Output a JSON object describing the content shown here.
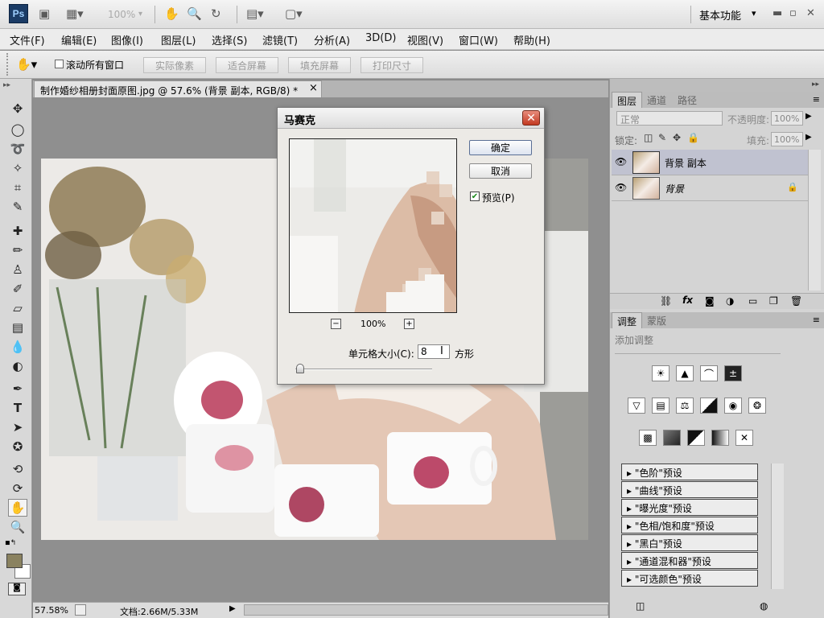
{
  "app": {
    "logo": "Ps",
    "workspace": "基本功能",
    "zoom_select": "100%"
  },
  "menu": [
    "文件(F)",
    "编辑(E)",
    "图像(I)",
    "图层(L)",
    "选择(S)",
    "滤镜(T)",
    "分析(A)",
    "3D(D)",
    "视图(V)",
    "窗口(W)",
    "帮助(H)"
  ],
  "options": {
    "scroll_all_label": "滚动所有窗口",
    "buttons": [
      "实际像素",
      "适合屏幕",
      "填充屏幕",
      "打印尺寸"
    ]
  },
  "document": {
    "tab_title": "制作婚纱相册封面原图.jpg @ 57.6% (背景 副本, RGB/8) *",
    "close_glyph": "×"
  },
  "status": {
    "zoom": "57.58%",
    "doc_info": "文档:2.66M/5.33M"
  },
  "dialog": {
    "title": "马赛克",
    "close_glyph": "✕",
    "ok": "确定",
    "cancel": "取消",
    "preview_label": "预览(P)",
    "preview_checked": true,
    "zoom_pct": "100%",
    "minus": "−",
    "plus": "+",
    "cell_size_label": "单元格大小(C):",
    "cell_size_value": "8",
    "cell_unit": "方形",
    "slider_pct": 2
  },
  "layers_panel": {
    "tabs": [
      "图层",
      "通道",
      "路径"
    ],
    "blend_mode": "正常",
    "opacity_label": "不透明度:",
    "opacity_value": "100%",
    "lock_label": "锁定:",
    "fill_label": "填充:",
    "fill_value": "100%",
    "layers": [
      {
        "name": "背景 副本",
        "selected": true,
        "locked": false
      },
      {
        "name": "背景",
        "selected": false,
        "locked": true
      }
    ]
  },
  "adjust_panel": {
    "tabs": [
      "调整",
      "蒙版"
    ],
    "add_label": "添加调整",
    "presets": [
      "\"色阶\"预设",
      "\"曲线\"预设",
      "\"曝光度\"预设",
      "\"色相/饱和度\"预设",
      "\"黑白\"预设",
      "\"通道混和器\"预设",
      "\"可选颜色\"预设"
    ]
  },
  "colors": {
    "accent": "#1b3c66",
    "foreground": "#8a8260",
    "background": "#ffffff"
  }
}
